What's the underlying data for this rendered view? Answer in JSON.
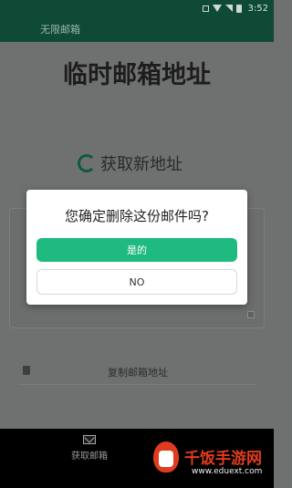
{
  "status_bar": {
    "time": "3:52"
  },
  "app_bar": {
    "title": "无限邮箱"
  },
  "main": {
    "title": "临时邮箱地址",
    "refresh_label": "获取新地址",
    "copy_label": "复制邮箱地址"
  },
  "bottom_nav": {
    "items": [
      {
        "label": "获取邮箱",
        "icon": "mail-icon"
      }
    ]
  },
  "watermark": {
    "text": "千饭手游网",
    "url": "www.eduext.com"
  },
  "dialog": {
    "message": "您确定删除这份邮件吗?",
    "confirm_label": "是的",
    "cancel_label": "NO"
  },
  "colors": {
    "primary_dark": "#0e4a36",
    "accent": "#1fba7f",
    "watermark": "#e03b1f"
  }
}
